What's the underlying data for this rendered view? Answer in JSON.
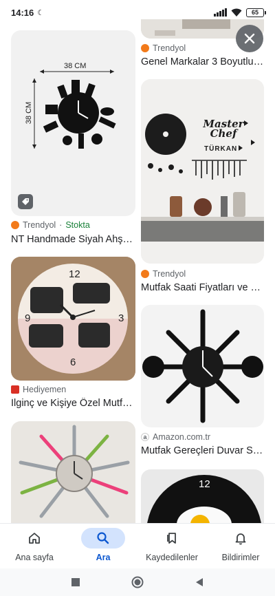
{
  "status": {
    "time": "14:16",
    "battery": "65"
  },
  "left_column": [
    {
      "source": "Trendyol",
      "stock": "Stokta",
      "title": "NT Handmade Siyah Ahş…",
      "dim_width": "38 CM",
      "dim_height": "38 CM"
    },
    {
      "source": "Hediyemen",
      "title": "İlginç ve Kişiye Özel Mutf…"
    },
    {
      "source": "",
      "title": ""
    }
  ],
  "right_column": [
    {
      "source": "Trendyol",
      "title": "Genel Markalar 3 Boyutlu…"
    },
    {
      "source": "Trendyol",
      "title": "Mutfak Saati Fiyatları ve …",
      "sign_main": "Master Chef",
      "sign_name": "TÜRKAN"
    },
    {
      "source": "Amazon.com.tr",
      "title": "Mutfak Gereçleri Duvar S…"
    },
    {
      "clock_twelve": "12"
    }
  ],
  "bottom_nav": [
    {
      "label": "Ana sayfa",
      "icon": "home-icon"
    },
    {
      "label": "Ara",
      "icon": "search-icon",
      "active": true
    },
    {
      "label": "Kaydedilenler",
      "icon": "bookmark-icon"
    },
    {
      "label": "Bildirimler",
      "icon": "bell-icon"
    }
  ],
  "colors": {
    "accent": "#0b57d0",
    "active_pill": "#d3e3fd",
    "stock": "#188038"
  }
}
